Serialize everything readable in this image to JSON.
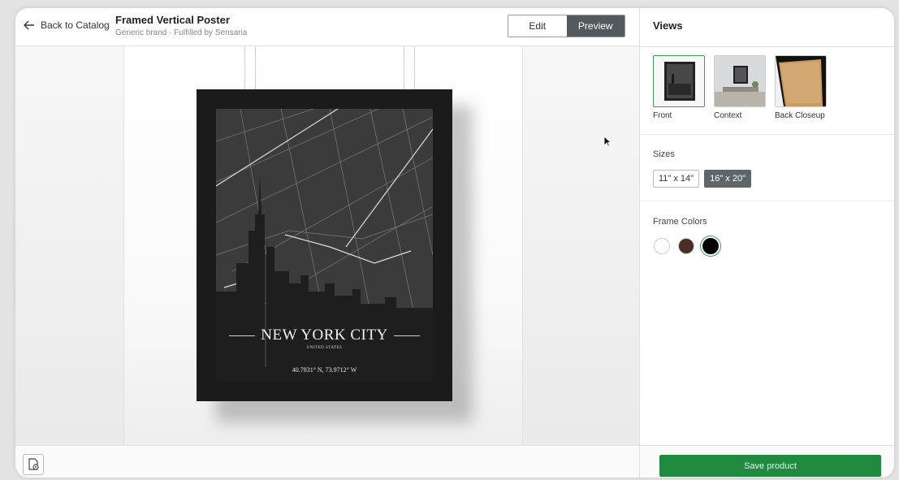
{
  "header": {
    "back_label": "Back to Catalog",
    "title": "Framed Vertical Poster",
    "subtitle": "Generic brand · Fulfilled by Sensaria",
    "modes": [
      "Edit",
      "Preview"
    ],
    "active_mode": "Preview"
  },
  "poster": {
    "city": "NEW YORK CITY",
    "country": "UNITED STATES",
    "coords": "40.7831° N, 73.9712° W"
  },
  "panel": {
    "views_title": "Views",
    "views": [
      {
        "label": "Front",
        "active": true
      },
      {
        "label": "Context",
        "active": false
      },
      {
        "label": "Back Closeup",
        "active": false
      }
    ],
    "sizes_label": "Sizes",
    "sizes": [
      {
        "label": "11\" x 14\"",
        "active": false
      },
      {
        "label": "16\" x 20\"",
        "active": true
      }
    ],
    "frame_colors_label": "Frame Colors",
    "frame_colors": [
      {
        "name": "white",
        "hex": "#ffffff",
        "active": false
      },
      {
        "name": "walnut",
        "hex": "#4a2e26",
        "active": false
      },
      {
        "name": "black",
        "hex": "#000000",
        "active": true
      }
    ],
    "save_label": "Save product"
  },
  "colors": {
    "accent": "#208a40",
    "preview_active": "#525a5d"
  }
}
